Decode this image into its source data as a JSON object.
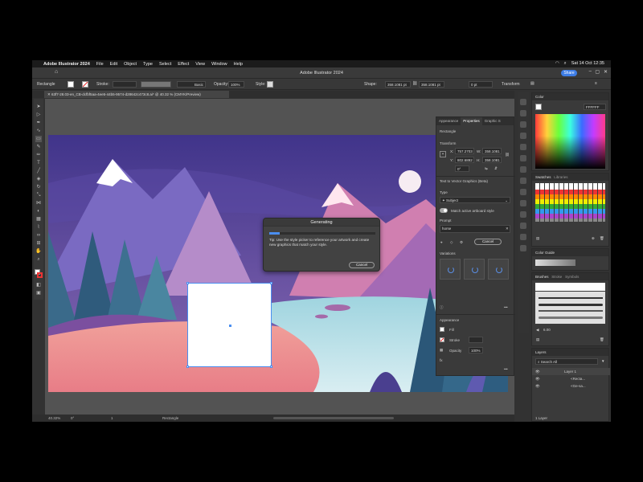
{
  "menubar": {
    "app_name": "Adobe Illustrator 2024",
    "items": [
      "File",
      "Edit",
      "Object",
      "Type",
      "Select",
      "Effect",
      "View",
      "Window",
      "Help"
    ],
    "datetime": "Sat 14 Oct  12:35"
  },
  "titlebar": {
    "title": "Adobe Illustrator 2024",
    "share_label": "Share"
  },
  "controlbar": {
    "selection_type": "Rectangle",
    "stroke_label": "Stroke:",
    "brush_label": "Basic",
    "opacity_label": "Opacity:",
    "opacity_value": "100%",
    "style_label": "Style:",
    "shape_label": "Shape:",
    "width_value": "358.1081 pt",
    "height_value": "358.1081 pt",
    "corner_value": "0 pt",
    "transform_label": "Transform"
  },
  "document_tab": {
    "title": "63f7-28.03-en_CB-dcfbf5aa-4ee5-44b5-9574-d28642c473c8.ai* @ 40.32 % (CMYK/Preview)"
  },
  "statusbar": {
    "zoom": "40.32%",
    "rotation": "0°",
    "page": "1",
    "tool": "Rectangle"
  },
  "properties_panel": {
    "tabs": [
      "Appearance",
      "Properties",
      "Graphic S"
    ],
    "selection": "Rectangle",
    "transform_label": "Transform",
    "x_label": "X:",
    "x_value": "757.2703",
    "y_label": "Y:",
    "y_value": "802.6892",
    "w_label": "W:",
    "w_value": "358.1081",
    "h_label": "H:",
    "h_value": "358.1081",
    "angle_value": "0°",
    "ttv_title": "Text to Vector Graphics (Beta)",
    "type_label": "Type",
    "type_value": "Subject",
    "match_label": "Match active artboard style",
    "prompt_label": "Prompt",
    "prompt_value": "horse",
    "cancel_label": "Cancel",
    "variations_label": "Variations",
    "appearance_label": "Appearance",
    "fill_label": "Fill",
    "stroke_label": "Stroke",
    "opacity_label": "Opacity",
    "opacity_value": "100%"
  },
  "color_panel": {
    "title": "Color",
    "hex": "FFFFFF"
  },
  "swatches_panel": {
    "tabs": [
      "Swatches",
      "Libraries"
    ]
  },
  "color_guide_panel": {
    "title": "Color Guide"
  },
  "brushes_panel": {
    "tabs": [
      "Brushes",
      "Stroke",
      "Symbols"
    ],
    "brush_name": "Basic",
    "size": "6.00"
  },
  "layers_panel": {
    "title": "Layers",
    "search_placeholder": "Search All",
    "layers": [
      {
        "name": "Layer 1"
      },
      {
        "name": "<Recta..."
      },
      {
        "name": "<Ge-sa..."
      }
    ],
    "footer": "1 Layer"
  },
  "dialog": {
    "title": "Generating",
    "progress": 0.1,
    "tip": "Tip: Use the style picker to reference your artwork and create new graphics that match your style.",
    "cancel_label": "Cancel"
  },
  "colors": {
    "accent": "#3d7de6",
    "sky_top": "#4a3b8c",
    "sky_bottom": "#7a5fa8",
    "ground_pink": "#e7888c",
    "water": "#7fc0d4"
  }
}
